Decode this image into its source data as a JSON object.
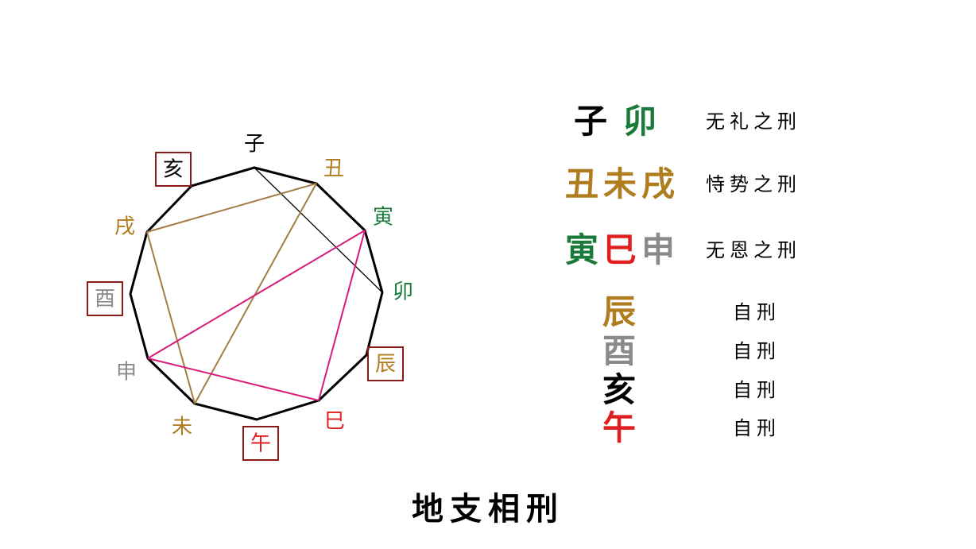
{
  "title": "地支相刑",
  "colors": {
    "black": "#000000",
    "gold": "#b07d1e",
    "green": "#1a7a3a",
    "red": "#e02020",
    "gray": "#8a8a8a",
    "box_border": "#8b1a1a",
    "line_gold": "#a67c45",
    "line_magenta": "#d81b7a",
    "line_black": "#000000"
  },
  "branches": [
    {
      "id": "zi",
      "char": "子",
      "color": "#000000",
      "boxed": false
    },
    {
      "id": "chou",
      "char": "丑",
      "color": "#b07d1e",
      "boxed": false
    },
    {
      "id": "yin",
      "char": "寅",
      "color": "#1a7a3a",
      "boxed": false
    },
    {
      "id": "mao",
      "char": "卯",
      "color": "#1a7a3a",
      "boxed": false
    },
    {
      "id": "chen",
      "char": "辰",
      "color": "#b07d1e",
      "boxed": true
    },
    {
      "id": "si",
      "char": "巳",
      "color": "#e02020",
      "boxed": false
    },
    {
      "id": "wu",
      "char": "午",
      "color": "#e02020",
      "boxed": true
    },
    {
      "id": "wei",
      "char": "未",
      "color": "#b07d1e",
      "boxed": false
    },
    {
      "id": "shen",
      "char": "申",
      "color": "#8a8a8a",
      "boxed": false
    },
    {
      "id": "you",
      "char": "酉",
      "color": "#8a8a8a",
      "boxed": true
    },
    {
      "id": "xu",
      "char": "戌",
      "color": "#b07d1e",
      "boxed": false
    },
    {
      "id": "hai",
      "char": "亥",
      "color": "#000000",
      "boxed": true
    }
  ],
  "connections": [
    {
      "from": "zi",
      "to": "mao",
      "color": "#000000"
    },
    {
      "from": "chou",
      "to": "wei",
      "color": "#a67c45"
    },
    {
      "from": "wei",
      "to": "xu",
      "color": "#a67c45"
    },
    {
      "from": "xu",
      "to": "chou",
      "color": "#a67c45"
    },
    {
      "from": "yin",
      "to": "si",
      "color": "#d81b7a"
    },
    {
      "from": "si",
      "to": "shen",
      "color": "#d81b7a"
    },
    {
      "from": "shen",
      "to": "yin",
      "color": "#d81b7a"
    }
  ],
  "legend": {
    "groups": [
      {
        "branches": [
          {
            "char": "子",
            "color": "#000000"
          },
          {
            "char": "卯",
            "color": "#1a7a3a"
          }
        ],
        "description": "无礼之刑"
      },
      {
        "branches": [
          {
            "char": "丑",
            "color": "#b07d1e"
          },
          {
            "char": "未",
            "color": "#b07d1e"
          },
          {
            "char": "戌",
            "color": "#b07d1e"
          }
        ],
        "description": "恃势之刑"
      },
      {
        "branches": [
          {
            "char": "寅",
            "color": "#1a7a3a"
          },
          {
            "char": "巳",
            "color": "#e02020"
          },
          {
            "char": "申",
            "color": "#8a8a8a"
          }
        ],
        "description": "无恩之刑"
      }
    ],
    "self_punishments": [
      {
        "char": "辰",
        "color": "#b07d1e",
        "description": "自刑"
      },
      {
        "char": "酉",
        "color": "#8a8a8a",
        "description": "自刑"
      },
      {
        "char": "亥",
        "color": "#000000",
        "description": "自刑"
      },
      {
        "char": "午",
        "color": "#e02020",
        "description": "自刑"
      }
    ]
  }
}
